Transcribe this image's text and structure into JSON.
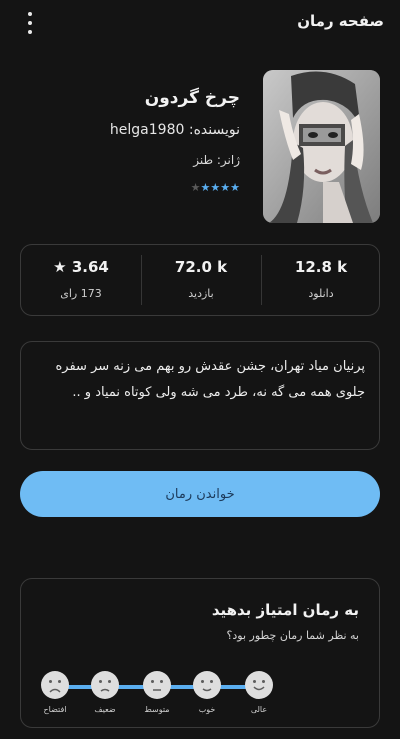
{
  "header": {
    "title": "صفحه رمان"
  },
  "book": {
    "title": "چرخ گردون",
    "author_label": "نویسنده: helga1980",
    "genre_label": "ژانر: طنز",
    "rating_stars": 4,
    "rating_max": 5
  },
  "stats": {
    "downloads": {
      "value": "12.8 k",
      "label": "دانلود"
    },
    "views": {
      "value": "72.0 k",
      "label": "بازدید"
    },
    "rating": {
      "value": "★ 3.64",
      "label": "173 رای"
    }
  },
  "summary": {
    "text": "پرنیان میاد تهران، جشن عقدش رو بهم می زنه سر سفره جلوی همه می گه نه، طرد می شه ولی کوتاه نمیاد و .."
  },
  "read_button": {
    "label": "خواندن رمان"
  },
  "rating_card": {
    "title": "به رمان امتیاز بدهید",
    "subtitle": "به نظر شما رمان چطور بود؟",
    "options": [
      "عالی",
      "خوب",
      "متوسط",
      "ضعیف",
      "افتضاح"
    ]
  },
  "colors": {
    "background": "#141414",
    "accent": "#5aaef0",
    "button": "#6fbcf4"
  }
}
